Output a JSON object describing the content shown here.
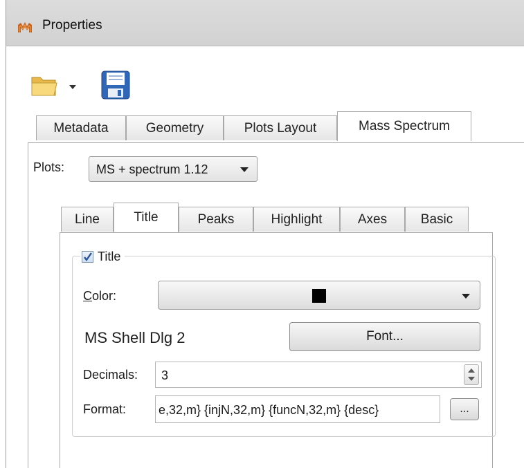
{
  "window": {
    "title": "Properties",
    "icon": "properties-app-icon"
  },
  "toolbar": {
    "open_icon": "folder-open-icon",
    "save_icon": "save-disk-icon"
  },
  "outer_tabs": [
    "Metadata",
    "Geometry",
    "Plots Layout",
    "Mass Spectrum"
  ],
  "outer_active": "Mass Spectrum",
  "plots": {
    "label": "Plots:",
    "selected": "MS + spectrum 1.12"
  },
  "inner_tabs": [
    "Line",
    "Title",
    "Peaks",
    "Highlight",
    "Axes",
    "Basic"
  ],
  "inner_active": "Title",
  "title_group": {
    "checkbox_label": "Title",
    "checked": true,
    "color_label_first": "C",
    "color_label_rest": "olor:",
    "color_value": "#000000",
    "font_name": "MS Shell Dlg 2",
    "font_button": "Font...",
    "decimals_label": "Decimals:",
    "decimals_value": "3",
    "format_label": "Format:",
    "format_value": "e,32,m} {injN,32,m} {funcN,32,m} {desc}",
    "ellipsis_button": "..."
  }
}
